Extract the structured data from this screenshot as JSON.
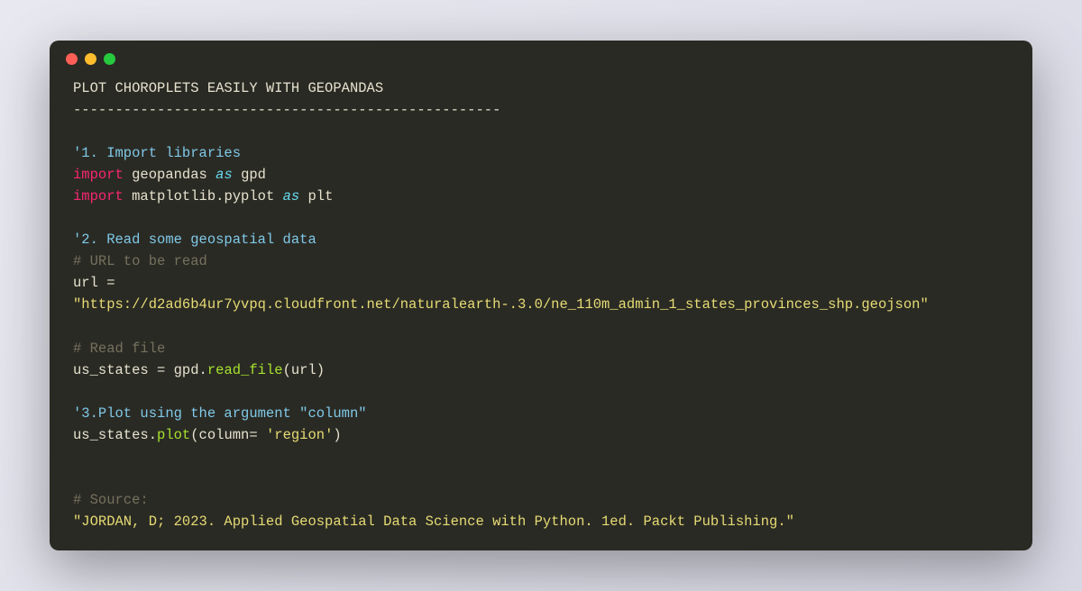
{
  "title": "PLOT CHOROPLETS EASILY WITH GEOPANDAS",
  "divider": "---------------------------------------------------",
  "section1_label": "'1. Import libraries",
  "import_kw1": "import",
  "geopandas": "geopandas",
  "as_kw1": "as",
  "gpd": "gpd",
  "import_kw2": "import",
  "matplotlib": "matplotlib.pyplot",
  "as_kw2": "as",
  "plt": "plt",
  "section2_label": "'2. Read some geospatial data",
  "comment_url": "# URL to be read",
  "url_var": "url",
  "eq1": " = ",
  "url_string": "\"https://d2ad6b4ur7yvpq.cloudfront.net/naturalearth-.3.0/ne_110m_admin_1_states_provinces_shp.geojson\"",
  "comment_readfile": "# Read file",
  "us_states1": "us_states",
  "eq2": " = ",
  "gpd_call": "gpd.",
  "read_file": "read_file",
  "paren_open1": "(",
  "url_arg": "url",
  "paren_close1": ")",
  "section3_label": "'3.Plot using the argument \"column\"",
  "us_states2": "us_states.",
  "plot_func": "plot",
  "paren_open2": "(",
  "column_kw": "column",
  "eq3": "= ",
  "region_str": "'region'",
  "paren_close2": ")",
  "comment_source": "# Source:",
  "source_string": "\"JORDAN, D; 2023. Applied Geospatial Data Science with Python. 1ed. Packt Publishing.\""
}
